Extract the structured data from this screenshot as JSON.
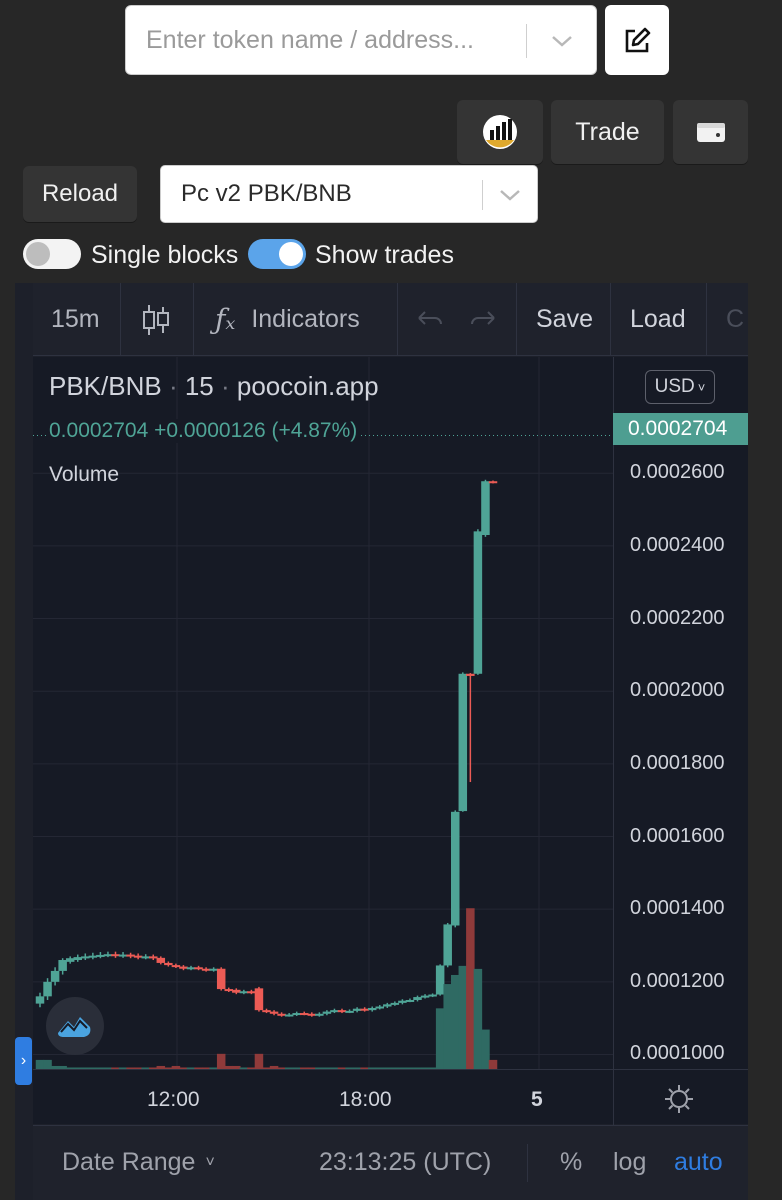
{
  "search": {
    "placeholder": "Enter token name / address..."
  },
  "header": {
    "trade_label": "Trade",
    "reload_label": "Reload",
    "pair_select": "Pc v2 PBK/BNB"
  },
  "toggles": [
    {
      "label": "Single blocks",
      "on": false
    },
    {
      "label": "Show trades",
      "on": true
    }
  ],
  "toolbar": {
    "interval": "15m",
    "indicators_label": "Indicators",
    "save_label": "Save",
    "load_label": "Load",
    "cut_label": "C"
  },
  "legend": {
    "symbol": "PBK/BNB",
    "interval": "15",
    "source": "poocoin.app",
    "price_line": "0.0002704 +0.0000126 (+4.87%)",
    "volume_label": "Volume",
    "currency": "USD",
    "currency_icon": "chevron-down-icon"
  },
  "current_price": "0.0002704",
  "colors": {
    "up": "#4fa496",
    "down": "#ec5b55",
    "up_volume": "#2f6a63",
    "down_volume": "#8f3a3a",
    "accent_blue": "#2f7de1",
    "price_tag": "#4e9e91"
  },
  "time_labels": [
    "12:00",
    "18:00",
    "5"
  ],
  "bottom": {
    "date_range": "Date Range",
    "clock": "23:13:25 (UTC)",
    "percent": "%",
    "log": "log",
    "auto": "auto"
  },
  "chart_data": {
    "type": "candlestick",
    "y_ticks": [
      "0.0002600",
      "0.0002400",
      "0.0002200",
      "0.0002000",
      "0.0001800",
      "0.0001600",
      "0.0001400",
      "0.0001200",
      "0.0001000"
    ],
    "ylim": [
      9.6e-05,
      0.000292
    ],
    "candles": [
      {
        "o": 0.000114,
        "c": 0.000116,
        "h": 0.000117,
        "l": 0.000113,
        "v": 3
      },
      {
        "o": 0.000116,
        "c": 0.00012,
        "h": 0.000121,
        "l": 0.000115,
        "v": 3
      },
      {
        "o": 0.00012,
        "c": 0.000123,
        "h": 0.000124,
        "l": 0.000119,
        "v": 1
      },
      {
        "o": 0.000123,
        "c": 0.000126,
        "h": 0.0001265,
        "l": 0.000122,
        "v": 1
      },
      {
        "o": 0.0001255,
        "c": 0.0001265,
        "h": 0.000127,
        "l": 0.000125,
        "v": 0.5
      },
      {
        "o": 0.000126,
        "c": 0.0001268,
        "h": 0.0001275,
        "l": 0.0001255,
        "v": 0.5
      },
      {
        "o": 0.0001265,
        "c": 0.000127,
        "h": 0.0001278,
        "l": 0.000126,
        "v": 0.5
      },
      {
        "o": 0.0001268,
        "c": 0.0001272,
        "h": 0.000128,
        "l": 0.0001262,
        "v": 0.5
      },
      {
        "o": 0.000127,
        "c": 0.0001274,
        "h": 0.0001282,
        "l": 0.0001265,
        "v": 0.5
      },
      {
        "o": 0.0001272,
        "c": 0.0001276,
        "h": 0.0001283,
        "l": 0.0001268,
        "v": 0.5
      },
      {
        "o": 0.0001276,
        "c": 0.0001272,
        "h": 0.0001283,
        "l": 0.0001266,
        "v": 0.5
      },
      {
        "o": 0.0001272,
        "c": 0.0001275,
        "h": 0.0001282,
        "l": 0.0001266,
        "v": 0.5
      },
      {
        "o": 0.0001275,
        "c": 0.0001272,
        "h": 0.000128,
        "l": 0.0001265,
        "v": 0.5
      },
      {
        "o": 0.0001272,
        "c": 0.0001268,
        "h": 0.0001278,
        "l": 0.0001262,
        "v": 0.5
      },
      {
        "o": 0.0001268,
        "c": 0.000127,
        "h": 0.0001276,
        "l": 0.0001262,
        "v": 0.5
      },
      {
        "o": 0.000127,
        "c": 0.0001266,
        "h": 0.0001275,
        "l": 0.000126,
        "v": 0.5
      },
      {
        "o": 0.0001266,
        "c": 0.0001252,
        "h": 0.000127,
        "l": 0.0001248,
        "v": 1
      },
      {
        "o": 0.0001252,
        "c": 0.0001246,
        "h": 0.0001256,
        "l": 0.0001242,
        "v": 0.5
      },
      {
        "o": 0.0001246,
        "c": 0.0001242,
        "h": 0.000125,
        "l": 0.0001238,
        "v": 1
      },
      {
        "o": 0.0001242,
        "c": 0.0001236,
        "h": 0.0001246,
        "l": 0.0001232,
        "v": 0.5
      },
      {
        "o": 0.0001236,
        "c": 0.000124,
        "h": 0.0001244,
        "l": 0.0001232,
        "v": 0.5
      },
      {
        "o": 0.000124,
        "c": 0.0001236,
        "h": 0.0001244,
        "l": 0.0001232,
        "v": 0.5
      },
      {
        "o": 0.0001236,
        "c": 0.0001232,
        "h": 0.000124,
        "l": 0.0001228,
        "v": 0.5
      },
      {
        "o": 0.0001232,
        "c": 0.0001236,
        "h": 0.000124,
        "l": 0.0001228,
        "v": 0.5
      },
      {
        "o": 0.0001236,
        "c": 0.000118,
        "h": 0.000124,
        "l": 0.0001176,
        "v": 5
      },
      {
        "o": 0.000118,
        "c": 0.0001178,
        "h": 0.0001184,
        "l": 0.0001172,
        "v": 1
      },
      {
        "o": 0.0001178,
        "c": 0.000117,
        "h": 0.0001182,
        "l": 0.0001166,
        "v": 1
      },
      {
        "o": 0.000117,
        "c": 0.0001174,
        "h": 0.0001178,
        "l": 0.0001166,
        "v": 0.5
      },
      {
        "o": 0.0001174,
        "c": 0.000117,
        "h": 0.0001178,
        "l": 0.0001166,
        "v": 0.5
      },
      {
        "o": 0.0001182,
        "c": 0.0001122,
        "h": 0.0001186,
        "l": 0.0001118,
        "v": 5
      },
      {
        "o": 0.0001122,
        "c": 0.0001118,
        "h": 0.0001126,
        "l": 0.0001114,
        "v": 0.5
      },
      {
        "o": 0.0001118,
        "c": 0.0001112,
        "h": 0.0001122,
        "l": 0.0001108,
        "v": 1
      },
      {
        "o": 0.0001112,
        "c": 0.0001108,
        "h": 0.0001116,
        "l": 0.0001104,
        "v": 0.5
      },
      {
        "o": 0.0001108,
        "c": 0.000111,
        "h": 0.0001114,
        "l": 0.0001104,
        "v": 0.5
      },
      {
        "o": 0.000111,
        "c": 0.0001114,
        "h": 0.0001118,
        "l": 0.0001106,
        "v": 0.5
      },
      {
        "o": 0.0001114,
        "c": 0.0001112,
        "h": 0.0001118,
        "l": 0.0001108,
        "v": 0.5
      },
      {
        "o": 0.0001112,
        "c": 0.0001108,
        "h": 0.0001116,
        "l": 0.0001104,
        "v": 0.5
      },
      {
        "o": 0.0001108,
        "c": 0.0001112,
        "h": 0.0001116,
        "l": 0.0001104,
        "v": 0.5
      },
      {
        "o": 0.0001112,
        "c": 0.0001118,
        "h": 0.0001122,
        "l": 0.0001108,
        "v": 0.5
      },
      {
        "o": 0.0001118,
        "c": 0.0001122,
        "h": 0.0001126,
        "l": 0.0001114,
        "v": 0.5
      },
      {
        "o": 0.0001122,
        "c": 0.0001118,
        "h": 0.0001126,
        "l": 0.0001114,
        "v": 0.5
      },
      {
        "o": 0.0001118,
        "c": 0.000112,
        "h": 0.0001124,
        "l": 0.0001114,
        "v": 0.5
      },
      {
        "o": 0.000112,
        "c": 0.0001126,
        "h": 0.000113,
        "l": 0.0001116,
        "v": 0.5
      },
      {
        "o": 0.0001126,
        "c": 0.0001122,
        "h": 0.000113,
        "l": 0.0001118,
        "v": 0.5
      },
      {
        "o": 0.0001122,
        "c": 0.0001128,
        "h": 0.0001132,
        "l": 0.0001118,
        "v": 0.5
      },
      {
        "o": 0.0001128,
        "c": 0.0001132,
        "h": 0.0001136,
        "l": 0.0001124,
        "v": 0.5
      },
      {
        "o": 0.0001132,
        "c": 0.0001138,
        "h": 0.0001142,
        "l": 0.0001128,
        "v": 0.5
      },
      {
        "o": 0.0001138,
        "c": 0.0001142,
        "h": 0.0001146,
        "l": 0.0001134,
        "v": 0.5
      },
      {
        "o": 0.0001142,
        "c": 0.0001148,
        "h": 0.0001152,
        "l": 0.0001138,
        "v": 0.5
      },
      {
        "o": 0.0001148,
        "c": 0.000115,
        "h": 0.0001154,
        "l": 0.0001144,
        "v": 0.5
      },
      {
        "o": 0.000115,
        "c": 0.0001158,
        "h": 0.0001162,
        "l": 0.0001146,
        "v": 0.5
      },
      {
        "o": 0.0001158,
        "c": 0.0001162,
        "h": 0.0001166,
        "l": 0.0001154,
        "v": 0.5
      },
      {
        "o": 0.0001162,
        "c": 0.0001165,
        "h": 0.0001168,
        "l": 0.0001158,
        "v": 0.5
      },
      {
        "o": 0.0001165,
        "c": 0.0001245,
        "h": 0.0001248,
        "l": 0.0001162,
        "v": 20
      },
      {
        "o": 0.0001245,
        "c": 0.0001358,
        "h": 0.0001362,
        "l": 0.000124,
        "v": 28
      },
      {
        "o": 0.0001355,
        "c": 0.0001668,
        "h": 0.0001672,
        "l": 0.000135,
        "v": 31
      },
      {
        "o": 0.000167,
        "c": 0.0002048,
        "h": 0.0002052,
        "l": 0.0001668,
        "v": 34
      },
      {
        "o": 0.0002048,
        "c": 0.0002042,
        "h": 0.000205,
        "l": 0.000175,
        "v": 53
      },
      {
        "o": 0.0002048,
        "c": 0.000244,
        "h": 0.0002446,
        "l": 0.0002045,
        "v": 33
      },
      {
        "o": 0.000243,
        "c": 0.0002578,
        "h": 0.0002582,
        "l": 0.0002425,
        "v": 13
      },
      {
        "o": 0.0002578,
        "c": 0.0002575,
        "h": 0.000258,
        "l": 0.0002572,
        "v": 3
      }
    ]
  }
}
